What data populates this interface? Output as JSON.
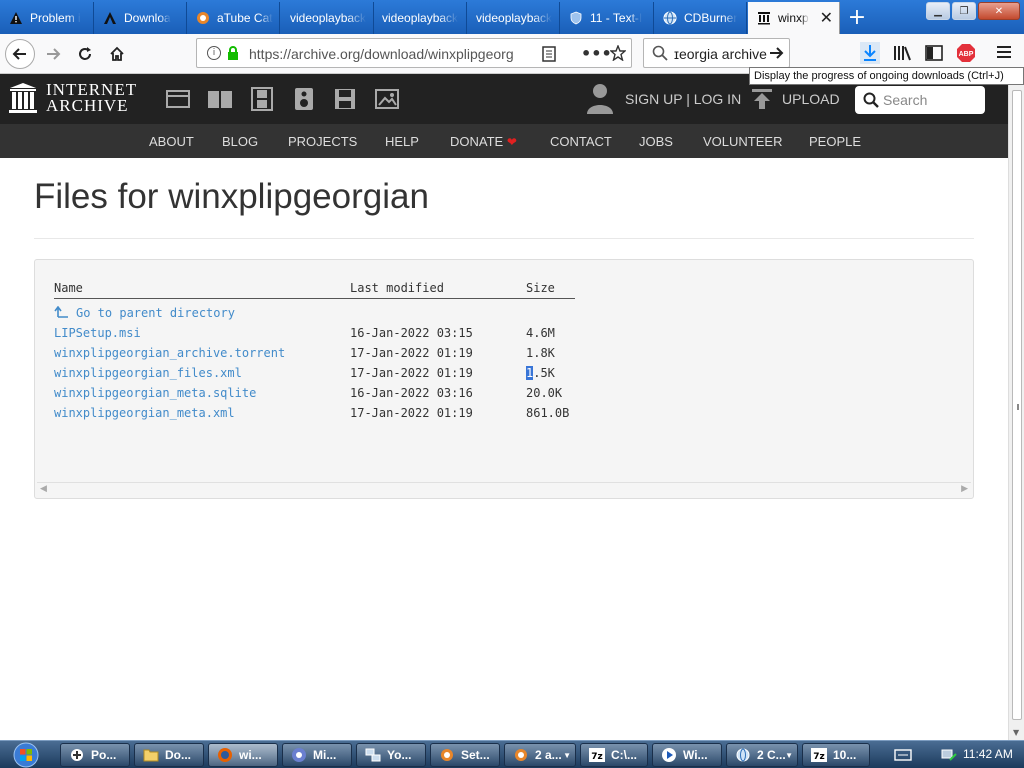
{
  "browser": {
    "tabs": [
      {
        "label": "Problem i",
        "icon": "warning-icon"
      },
      {
        "label": "Downloa",
        "icon": "a-logo-icon"
      },
      {
        "label": "aTube Cat",
        "icon": "atube-icon"
      },
      {
        "label": "videoplayback",
        "icon": ""
      },
      {
        "label": "videoplayback",
        "icon": ""
      },
      {
        "label": "videoplayback",
        "icon": ""
      },
      {
        "label": "11 - Text-I",
        "icon": "shield-icon"
      },
      {
        "label": "CDBurner",
        "icon": "globe-icon"
      },
      {
        "label": "winxp",
        "icon": "archive-icon"
      }
    ],
    "url": "https://archive.org/download/winxplipgeorg",
    "search_value": "ɪeorgia archive",
    "tooltip": "Display the progress of ongoing downloads (Ctrl+J)"
  },
  "archive": {
    "logo_line1": "INTERNET",
    "logo_line2": "ARCHIVE",
    "signup": "SIGN UP | LOG IN",
    "upload": "UPLOAD",
    "search_placeholder": "Search",
    "nav": [
      "ABOUT",
      "BLOG",
      "PROJECTS",
      "HELP",
      "DONATE",
      "CONTACT",
      "JOBS",
      "VOLUNTEER",
      "PEOPLE"
    ]
  },
  "page": {
    "title": "Files for winxplipgeorgian",
    "headers": {
      "name": "Name",
      "modified": "Last modified",
      "size": "Size"
    },
    "parent": "Go to parent directory",
    "files": [
      {
        "name": "LIPSetup.msi",
        "modified": "16-Jan-2022 03:15",
        "size": "4.6M"
      },
      {
        "name": "winxplipgeorgian_archive.torrent",
        "modified": "17-Jan-2022 01:19",
        "size": "1.8K"
      },
      {
        "name": "winxplipgeorgian_files.xml",
        "modified": "17-Jan-2022 01:19",
        "size": "1.5K",
        "size_selected": "1",
        "size_rest": ".5K"
      },
      {
        "name": "winxplipgeorgian_meta.sqlite",
        "modified": "16-Jan-2022 03:16",
        "size": "20.0K"
      },
      {
        "name": "winxplipgeorgian_meta.xml",
        "modified": "17-Jan-2022 01:19",
        "size": "861.0B"
      }
    ]
  },
  "taskbar": {
    "items": [
      {
        "label": "Po...",
        "icon": "plus-circle-icon"
      },
      {
        "label": "Do...",
        "icon": "folder-icon"
      },
      {
        "label": "wi...",
        "icon": "firefox-icon"
      },
      {
        "label": "Mi...",
        "icon": "app-icon"
      },
      {
        "label": "Yo...",
        "icon": "network-icon"
      },
      {
        "label": "Set...",
        "icon": "atube-icon"
      },
      {
        "label": "2 a...",
        "icon": "atube-icon"
      },
      {
        "label": "C:\\...",
        "icon": "sevenzip-icon"
      },
      {
        "label": "Wi...",
        "icon": "media-icon"
      },
      {
        "label": "2 C...",
        "icon": "globe-icon"
      },
      {
        "label": "10...",
        "icon": "sevenzip-icon"
      }
    ],
    "clock": "11:42 AM"
  },
  "colors": {
    "link": "#428bca",
    "tabstrip": "#1c68c9",
    "archive_header": "#222222",
    "archive_nav": "#333333",
    "donate_heart": "#e02020"
  }
}
